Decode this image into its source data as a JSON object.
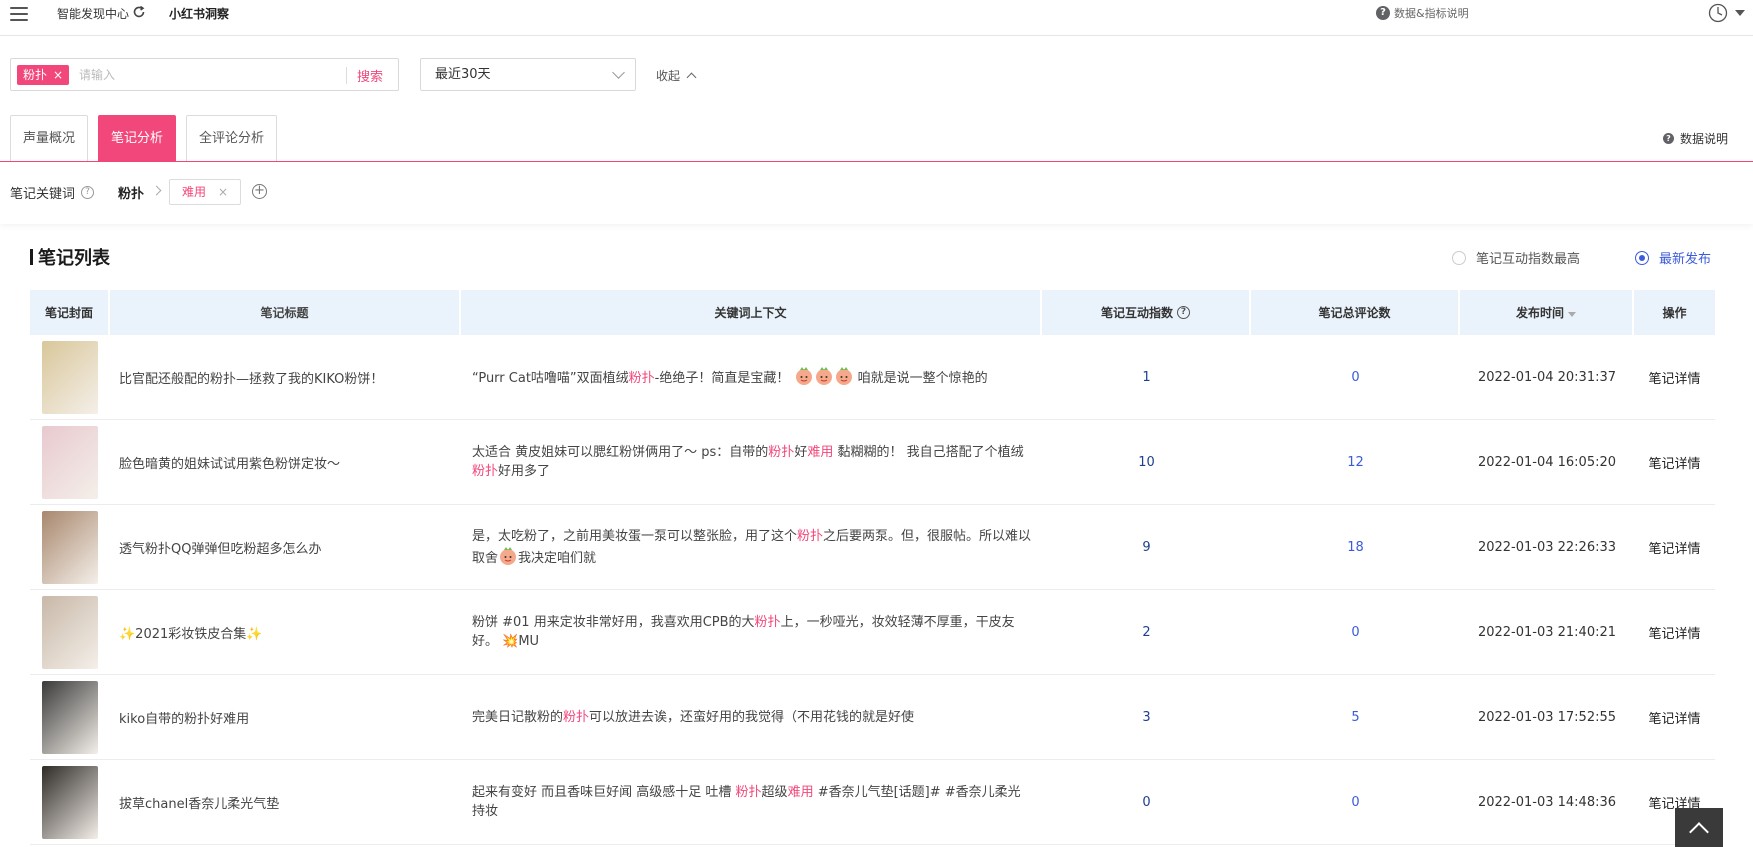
{
  "topbar": {
    "app_title": "智能发现中心",
    "sub_title": "小红书洞察",
    "help_text": "数据&指标说明"
  },
  "search": {
    "tag": "粉扑",
    "tag_remove": "×",
    "placeholder": "请输入",
    "button": "搜索",
    "date_range": "最近30天",
    "collapse": "收起"
  },
  "tabs": [
    {
      "label": "声量概况",
      "active": false
    },
    {
      "label": "笔记分析",
      "active": true
    },
    {
      "label": "全评论分析",
      "active": false
    }
  ],
  "data_desc": "数据说明",
  "keywords": {
    "label": "笔记关键词",
    "root": "粉扑",
    "chip": "难用",
    "chip_remove": "×",
    "add": "+"
  },
  "section": {
    "title": "笔记列表",
    "sort_options": [
      {
        "label": "笔记互动指数最高",
        "selected": false
      },
      {
        "label": "最新发布",
        "selected": true
      }
    ]
  },
  "table": {
    "columns": [
      "笔记封面",
      "笔记标题",
      "关键词上下文",
      "笔记互动指数",
      "笔记总评论数",
      "发布时间",
      "操作"
    ],
    "rows": [
      {
        "title": "比官配还般配的粉扑—拯救了我的KIKO粉饼！",
        "context": [
          [
            "“Purr Cat咕噜喵”双面植绒",
            ""
          ],
          [
            "粉扑",
            "hl"
          ],
          [
            "-绝绝子！简直是宝藏！ ",
            ""
          ],
          [
            "EMOJI3",
            "emoji"
          ],
          [
            " 咱就是说一整个惊艳的",
            ""
          ]
        ],
        "interaction": "1",
        "comments": "0",
        "time": "2022-01-04 20:31:37",
        "action": "笔记详情",
        "cover": "#d9c79a"
      },
      {
        "title": "脸色暗黄的姐妹试试用紫色粉饼定妆～",
        "context": [
          [
            "太适合 黄皮姐妹可以腮红粉饼俩用了～ ps：自带的",
            ""
          ],
          [
            "粉扑",
            "hl"
          ],
          [
            "好",
            ""
          ],
          [
            "难用",
            "hl"
          ],
          [
            " 黏糊糊的！ 我自己搭配了个植绒",
            ""
          ],
          [
            "粉扑",
            "hl"
          ],
          [
            "好用多了",
            ""
          ]
        ],
        "interaction": "10",
        "comments": "12",
        "time": "2022-01-04 16:05:20",
        "action": "笔记详情",
        "cover": "#e8c9cf"
      },
      {
        "title": "透气粉扑QQ弹弹但吃粉超多怎么办",
        "context": [
          [
            "是，太吃粉了，之前用美妆蛋一泵可以整张脸，用了这个",
            ""
          ],
          [
            "粉扑",
            "hl"
          ],
          [
            "之后要两泵。但，很服帖。所以难以取舍",
            ""
          ],
          [
            "EMOJI1",
            "emoji"
          ],
          [
            "我决定咱们就",
            ""
          ]
        ],
        "interaction": "9",
        "comments": "18",
        "time": "2022-01-03 22:26:33",
        "action": "笔记详情",
        "cover": "#a8876d"
      },
      {
        "title": "✨2021彩妆铁皮合集✨",
        "context": [
          [
            "粉饼 #01 用来定妆非常好用，我喜欢用CPB的大",
            ""
          ],
          [
            "粉扑",
            "hl"
          ],
          [
            "上，一秒哑光，妆效轻薄不厚重，干皮友好。 💥MU",
            ""
          ]
        ],
        "interaction": "2",
        "comments": "0",
        "time": "2022-01-03 21:40:21",
        "action": "笔记详情",
        "cover": "#c8b8a8"
      },
      {
        "title": "kiko自带的粉扑好难用",
        "context": [
          [
            "完美日记散粉的",
            ""
          ],
          [
            "粉扑",
            "hl"
          ],
          [
            "可以放进去诶，还蛮好用的我觉得（不用花钱的就是好使",
            ""
          ]
        ],
        "interaction": "3",
        "comments": "5",
        "time": "2022-01-03 17:52:55",
        "action": "笔记详情",
        "cover": "#3a3a3a"
      },
      {
        "title": "拔草chanel香奈儿柔光气垫",
        "context": [
          [
            "起来有变好 而且香味巨好闻 高级感十足 吐槽 ",
            ""
          ],
          [
            "粉扑",
            "hl"
          ],
          [
            "超级",
            ""
          ],
          [
            "难用",
            "hl"
          ],
          [
            " #香奈儿气垫[话题]# #香奈儿柔光持妆",
            ""
          ]
        ],
        "interaction": "0",
        "comments": "0",
        "time": "2022-01-03 14:48:36",
        "action": "笔记详情",
        "cover": "#2e2a26"
      }
    ]
  },
  "colors": {
    "accent": "#f2477a",
    "header_bg": "#eaf3fb",
    "link_blue": "#3b5bdb",
    "num_navy": "#1d3f8f"
  }
}
